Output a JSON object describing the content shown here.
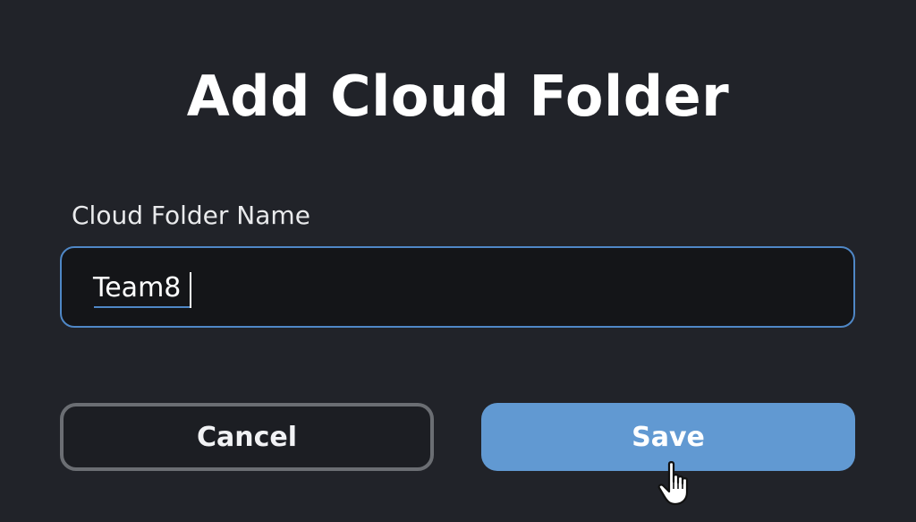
{
  "dialog": {
    "title": "Add Cloud Folder",
    "field_label": "Cloud Folder Name",
    "input_value": "Team8",
    "cancel_label": "Cancel",
    "save_label": "Save"
  },
  "colors": {
    "background": "#212329",
    "accent": "#4f87c6",
    "save_button": "#6199d2",
    "input_background": "#141518"
  },
  "icons": {
    "cursor": "hand-pointer-icon"
  }
}
